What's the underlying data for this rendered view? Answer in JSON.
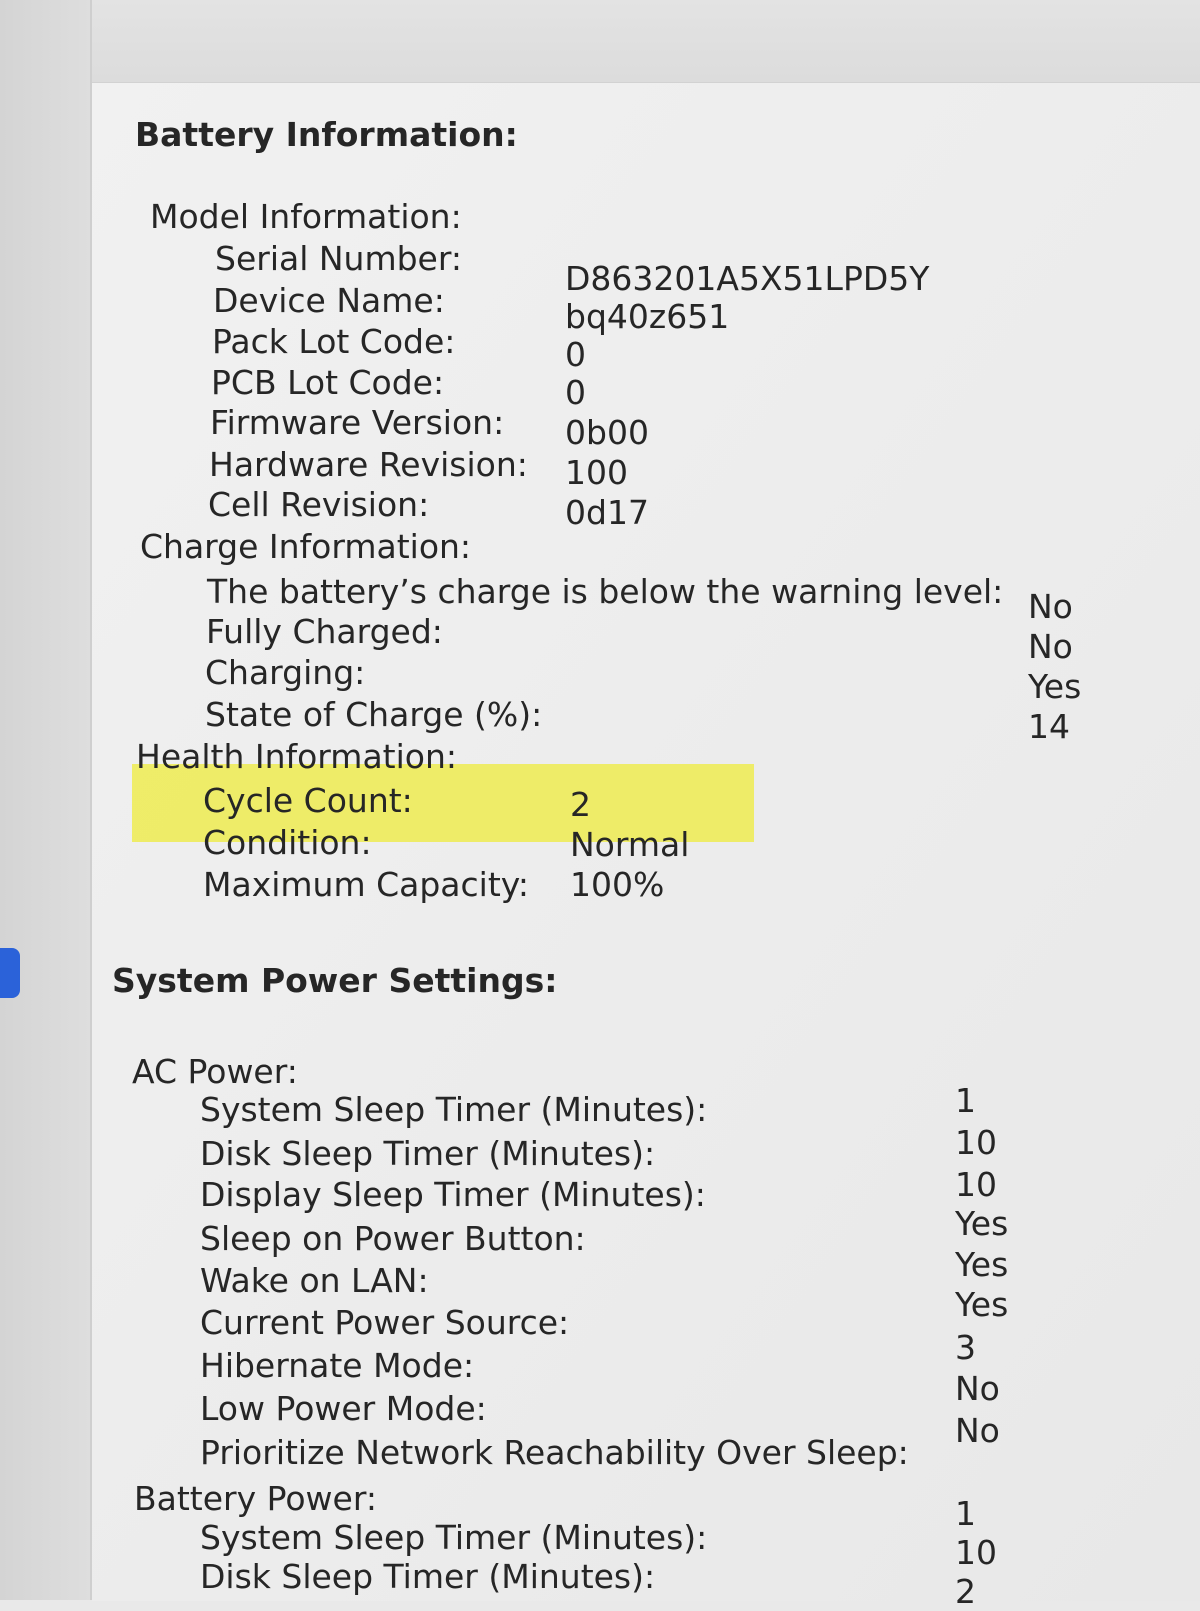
{
  "battery": {
    "heading": "Battery Information:",
    "model": {
      "heading": "Model Information:",
      "serial_label": "Serial Number:",
      "serial_value": "D863201A5X51LPD5Y",
      "device_label": "Device Name:",
      "device_value": "bq40z651",
      "pack_lot_label": "Pack Lot Code:",
      "pack_lot_value": "0",
      "pcb_lot_label": "PCB Lot Code:",
      "pcb_lot_value": "0",
      "firmware_label": "Firmware Version:",
      "firmware_value": "0b00",
      "hardware_label": "Hardware Revision:",
      "hardware_value": "100",
      "cell_label": "Cell Revision:",
      "cell_value": "0d17"
    },
    "charge": {
      "heading": "Charge Information:",
      "warning_label": "The battery’s charge is below the warning level:",
      "warning_value": "No",
      "fully_label": "Fully Charged:",
      "fully_value": "No",
      "charging_label": "Charging:",
      "charging_value": "Yes",
      "soc_label": "State of Charge (%):",
      "soc_value": "14"
    },
    "health": {
      "heading": "Health Information:",
      "cycle_label": "Cycle Count:",
      "cycle_value": "2",
      "condition_label": "Condition:",
      "condition_value": "Normal",
      "max_cap_label": "Maximum Capacity:",
      "max_cap_value": "100%"
    }
  },
  "power": {
    "heading": "System Power Settings:",
    "ac": {
      "heading": "AC Power:",
      "rows": [
        {
          "label": "System Sleep Timer (Minutes):",
          "value": "1"
        },
        {
          "label": "Disk Sleep Timer (Minutes):",
          "value": "10"
        },
        {
          "label": "Display Sleep Timer (Minutes):",
          "value": "10"
        },
        {
          "label": "Sleep on Power Button:",
          "value": "Yes"
        },
        {
          "label": "Wake on LAN:",
          "value": "Yes"
        },
        {
          "label": "Current Power Source:",
          "value": "Yes"
        },
        {
          "label": "Hibernate Mode:",
          "value": "3"
        },
        {
          "label": "Low Power Mode:",
          "value": "No"
        },
        {
          "label": "Prioritize Network Reachability Over Sleep:",
          "value": "No"
        }
      ]
    },
    "battery_power": {
      "heading": "Battery Power:",
      "rows": [
        {
          "label": "System Sleep Timer (Minutes):",
          "value": "1"
        },
        {
          "label": "Disk Sleep Timer (Minutes):",
          "value": "10"
        },
        {
          "label": "",
          "value": "2"
        }
      ]
    }
  },
  "colors": {
    "highlight": "#eeec42",
    "selection": "#2b62d9"
  }
}
